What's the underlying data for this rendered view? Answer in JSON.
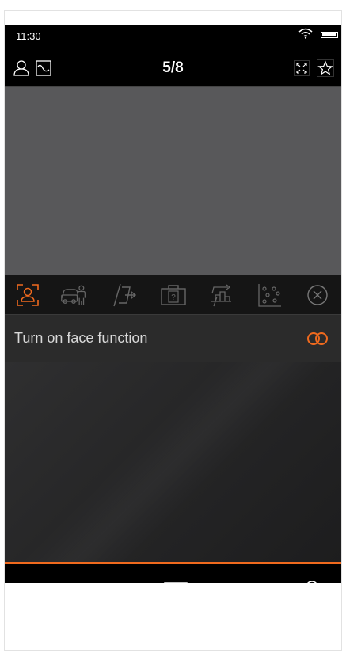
{
  "status_bar": {
    "time": "11:30",
    "wifi_icon": "wifi-icon",
    "battery_icon": "battery-icon"
  },
  "header": {
    "title": "5/8",
    "left_icons": [
      "person-icon",
      "chart-icon"
    ],
    "right_icons": [
      "fullscreen-icon",
      "star-icon"
    ]
  },
  "function_toolbar": {
    "items": [
      {
        "icon": "face-detect-icon",
        "active": true
      },
      {
        "icon": "vehicle-person-icon",
        "active": false
      },
      {
        "icon": "line-crossing-icon",
        "active": false
      },
      {
        "icon": "unattended-object-icon",
        "active": false
      },
      {
        "icon": "people-counting-icon",
        "active": false
      },
      {
        "icon": "crowd-density-icon",
        "active": false
      },
      {
        "icon": "close-circle-icon",
        "active": false
      }
    ]
  },
  "face_row": {
    "label": "Turn on face function",
    "toggle_icon": "toggle-icon",
    "toggle_on": true
  },
  "bottom_toolbar": {
    "items": [
      "camera-icon",
      "video-record-icon",
      "grid-layout-icon",
      "mute-icon",
      "microphone-icon"
    ]
  },
  "colors": {
    "accent": "#f06a1e",
    "background": "#000000",
    "video": "#58585a"
  }
}
